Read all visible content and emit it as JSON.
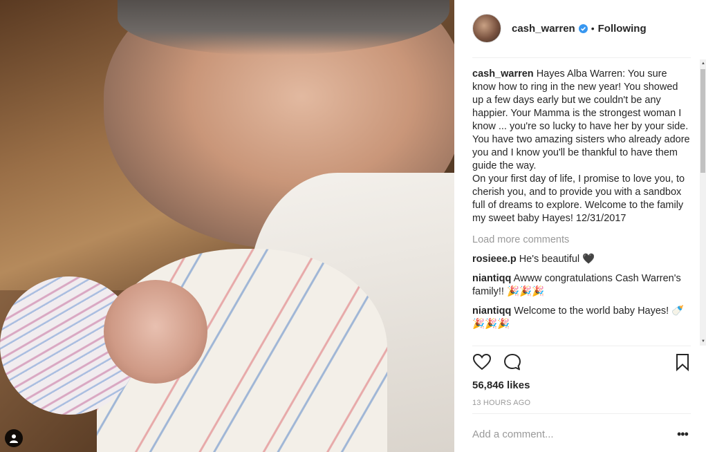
{
  "post": {
    "username": "cash_warren",
    "follow_status": "Following",
    "separator": "•",
    "caption_lines": [
      "Hayes Alba Warren: You sure know how to ring in the new year! You showed up a few days early but we couldn't be any happier. Your Mamma is the strongest woman I know ... you're so lucky to have her by your side. You have two amazing sisters who already adore you and I know you'll be thankful to have them guide the way.",
      "On your first day of life, I promise to love you, to cherish you, and to provide you with a sandbox full of dreams to explore. Welcome to the family my sweet baby Hayes! 12/31/2017"
    ],
    "load_more": "Load more comments",
    "comments": [
      {
        "user": "rosieee.p",
        "text": "He's beautiful 🖤"
      },
      {
        "user": "niantiqq",
        "text": "Awww congratulations Cash Warren's family!! 🎉🎉🎉"
      },
      {
        "user": "niantiqq",
        "text": "Welcome to the world baby Hayes! 🍼🎉🎉🎉"
      }
    ],
    "likes": "56,846 likes",
    "timestamp": "13 HOURS AGO",
    "add_comment_placeholder": "Add a comment...",
    "more_options": "•••"
  },
  "colors": {
    "verified_blue": "#3897f0",
    "muted_text": "#999999"
  },
  "icons": {
    "like": "heart-icon",
    "comment": "comment-icon",
    "save": "bookmark-icon",
    "user_tag": "user-tag-icon",
    "verified": "verified-badge-icon"
  }
}
